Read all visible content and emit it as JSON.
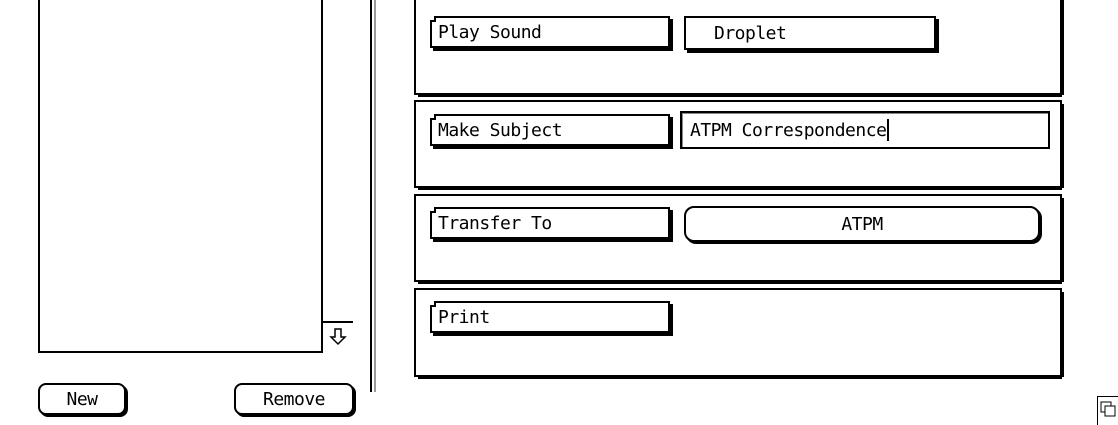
{
  "list_pane": {
    "scroll_icon": "down-arrow-icon"
  },
  "buttons": {
    "new_label": "New",
    "remove_label": "Remove"
  },
  "actions": [
    {
      "action": "Play Sound",
      "value": "Droplet"
    },
    {
      "action": "Make Subject",
      "value": "ATPM Correspondence"
    },
    {
      "action": "Transfer To",
      "value": "ATPM"
    },
    {
      "action": "Print",
      "value": ""
    }
  ],
  "window": {
    "grow_icon": "resize-grow-icon"
  }
}
